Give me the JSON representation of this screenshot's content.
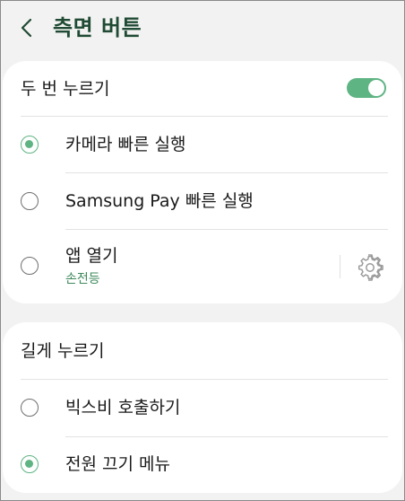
{
  "header": {
    "title": "측면 버튼",
    "back_icon": "chevron-left-icon"
  },
  "double_press": {
    "title": "두 번 누르기",
    "toggle_on": true,
    "accent_color": "#5fb483",
    "options": [
      {
        "label": "카메라 빠른 실행",
        "selected": true
      },
      {
        "label": "Samsung Pay 빠른 실행",
        "selected": false
      },
      {
        "label": "앱 열기",
        "sublabel": "손전등",
        "selected": false,
        "settings_icon": "gear-icon"
      }
    ]
  },
  "long_press": {
    "title": "길게 누르기",
    "options": [
      {
        "label": "빅스비 호출하기",
        "selected": false
      },
      {
        "label": "전원 끄기 메뉴",
        "selected": true
      }
    ]
  }
}
